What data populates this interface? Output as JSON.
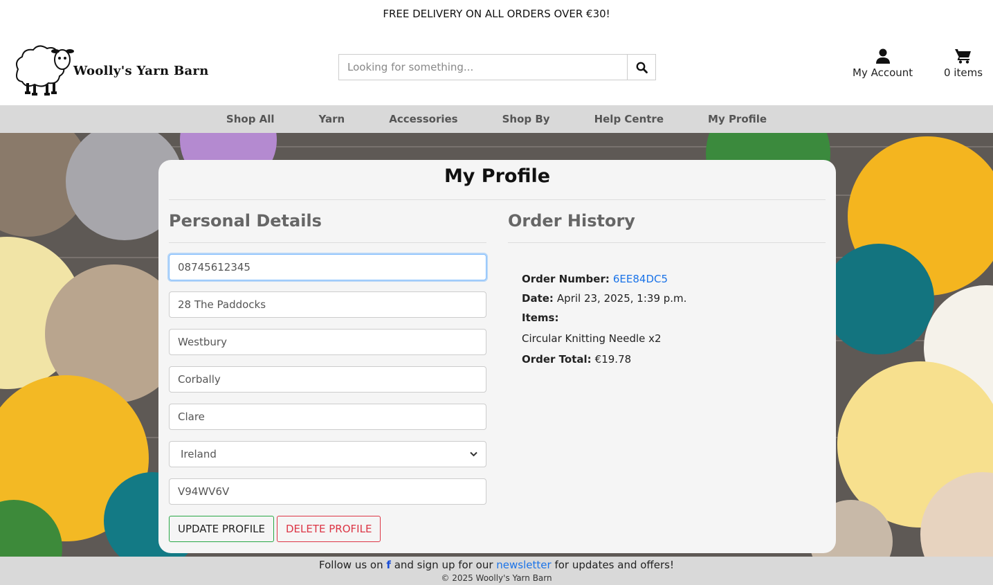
{
  "promo": {
    "text": "FREE DELIVERY ON ALL ORDERS OVER €30!"
  },
  "brand": {
    "name": "Woolly's Yarn Barn"
  },
  "search": {
    "placeholder": "Looking for something...",
    "icon": "search-icon"
  },
  "header": {
    "account_label": "My Account",
    "bag_label": "0 items"
  },
  "nav": {
    "items": [
      {
        "label": "Shop All"
      },
      {
        "label": "Yarn"
      },
      {
        "label": "Accessories"
      },
      {
        "label": "Shop By"
      },
      {
        "label": "Help Centre"
      },
      {
        "label": "My Profile"
      }
    ]
  },
  "profile": {
    "title": "My Profile",
    "personal_title": "Personal Details",
    "fields": {
      "phone": "08745612345",
      "street1": "28 The Paddocks",
      "street2": "Westbury",
      "town": "Corbally",
      "county": "Clare",
      "country": "Ireland",
      "postcode": "V94WV6V"
    },
    "update_label": "UPDATE PROFILE",
    "delete_label": "DELETE PROFILE"
  },
  "orders": {
    "title": "Order History",
    "number_label": "Order Number:",
    "number": "6EE84DC5",
    "date_label": "Date:",
    "date": "April 23, 2025, 1:39 p.m.",
    "items_label": "Items:",
    "item": "Circular Knitting Needle x2",
    "total_label": "Order Total:",
    "total": "€19.78"
  },
  "footer": {
    "follow_prefix": "Follow us on",
    "fb_glyph": "f",
    "follow_mid": "and sign up for our",
    "newsletter": "newsletter",
    "follow_suffix": "for updates and offers!",
    "copyright": "© 2025 Woolly's Yarn Barn"
  },
  "colors": {
    "accent_link": "#1a73e8",
    "update_border": "#28a745",
    "delete": "#dc3545",
    "nav_bg": "#d9d9d9"
  }
}
